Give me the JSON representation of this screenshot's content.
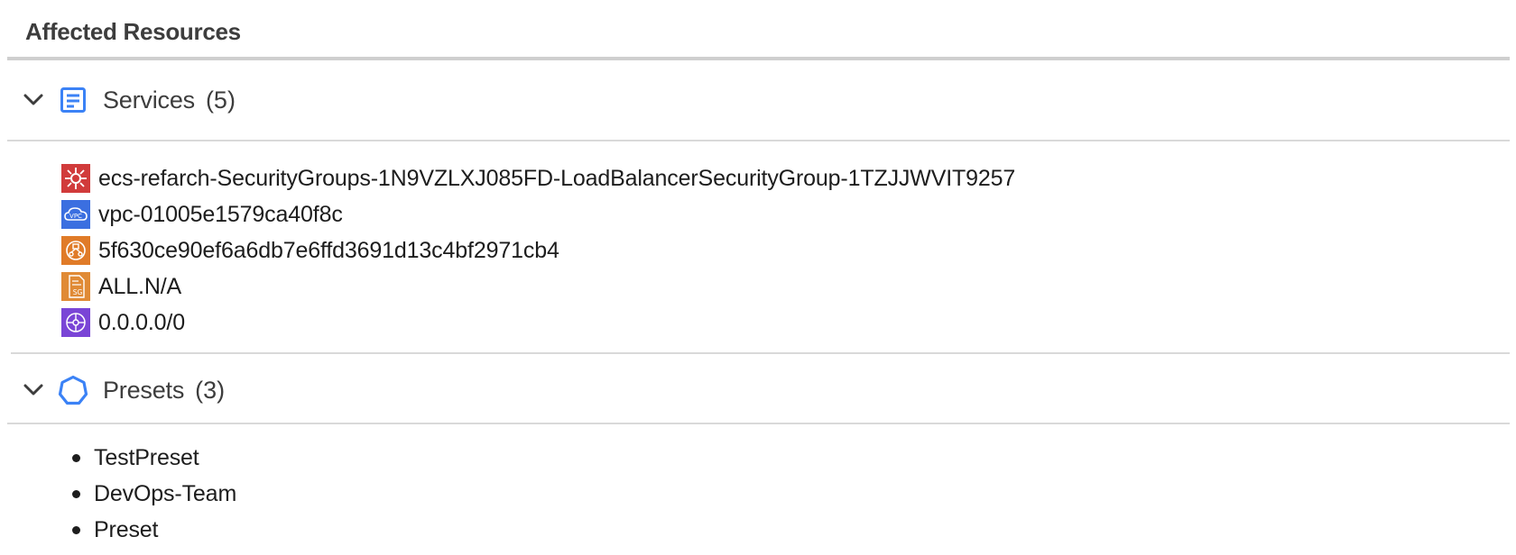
{
  "panel": {
    "title": "Affected Resources"
  },
  "services": {
    "label": "Services",
    "count": "(5)",
    "icon": "document-list-icon",
    "items": [
      {
        "label": "ecs-refarch-SecurityGroups-1N9VZLXJ085FD-LoadBalancerSecurityGroup-1TZJJWVIT9257",
        "icon": "security-group-icon",
        "color": "#d13b3b"
      },
      {
        "label": "vpc-01005e1579ca40f8c",
        "icon": "vpc-icon",
        "color": "#3b6fe0"
      },
      {
        "label": "5f630ce90ef6a6db7e6ffd3691d13c4bf2971cb4",
        "icon": "load-balancer-icon",
        "color": "#e07b28"
      },
      {
        "label": "ALL.N/A",
        "icon": "sg-document-icon",
        "color": "#e08a35"
      },
      {
        "label": "0.0.0.0/0",
        "icon": "network-hub-icon",
        "color": "#7a45d6"
      }
    ]
  },
  "presets": {
    "label": "Presets",
    "count": "(3)",
    "icon": "hexagon-icon",
    "items": [
      {
        "label": "TestPreset"
      },
      {
        "label": "DevOps-Team"
      },
      {
        "label": "Preset"
      }
    ]
  },
  "colors": {
    "accent": "#3b82f6",
    "rule": "#d9d9d9"
  }
}
